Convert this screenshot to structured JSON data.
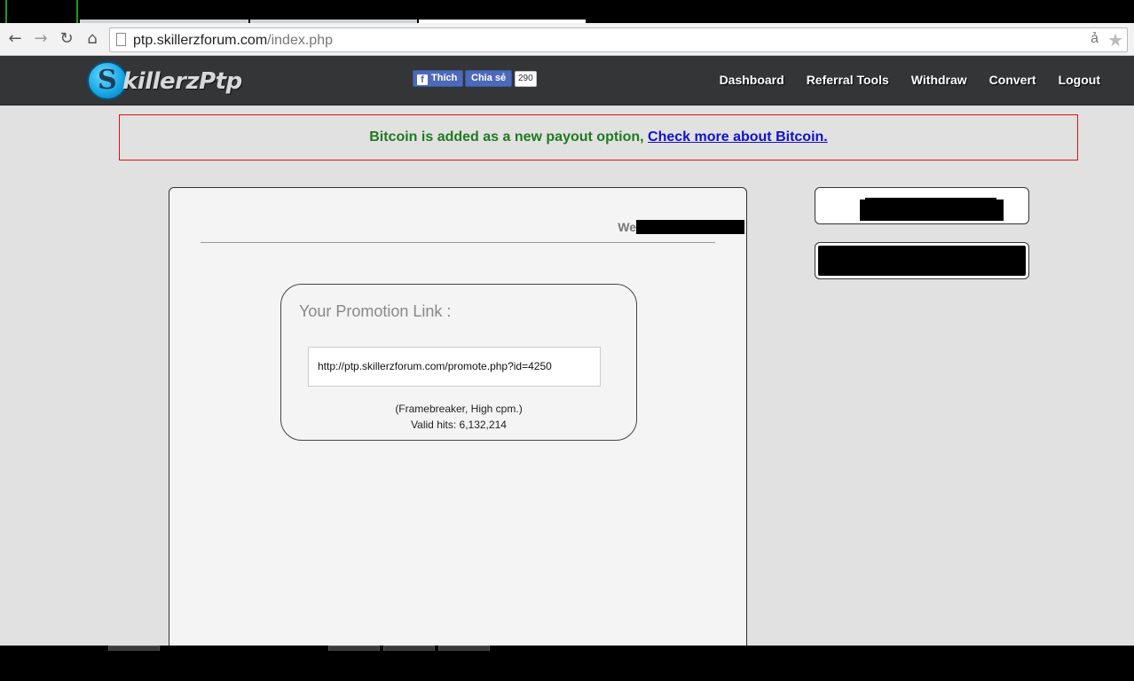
{
  "browser": {
    "url_host": "ptp.skillerzforum.com",
    "url_path": "/index.php",
    "back_icon": "arrow-left",
    "forward_icon": "arrow-right",
    "reload_icon": "reload",
    "home_icon": "home",
    "extension_icon_glyph": "ả",
    "star_glyph": "★"
  },
  "header": {
    "logo_letter": "S",
    "logo_text": "killerzPtp",
    "fb_like_label": "Thích",
    "fb_share_label": "Chia sẻ",
    "fb_share_count": "290",
    "nav": [
      "Dashboard",
      "Referral Tools",
      "Withdraw",
      "Convert",
      "Logout"
    ]
  },
  "notice": {
    "message": "Bitcoin is added as a new payout option, ",
    "link_text": "Check more about Bitcoin.",
    "message_color": "#1f7a1f",
    "link_color": "#1010cc",
    "border_color": "#dd1111"
  },
  "main": {
    "welcome_prefix": "We",
    "promo_title": "Your Promotion Link :",
    "promo_link": "http://ptp.skillerzforum.com/promote.php?id=4250",
    "promo_note": "(Framebreaker, High cpm.)",
    "valid_hits": "Valid hits: 6,132,214"
  }
}
